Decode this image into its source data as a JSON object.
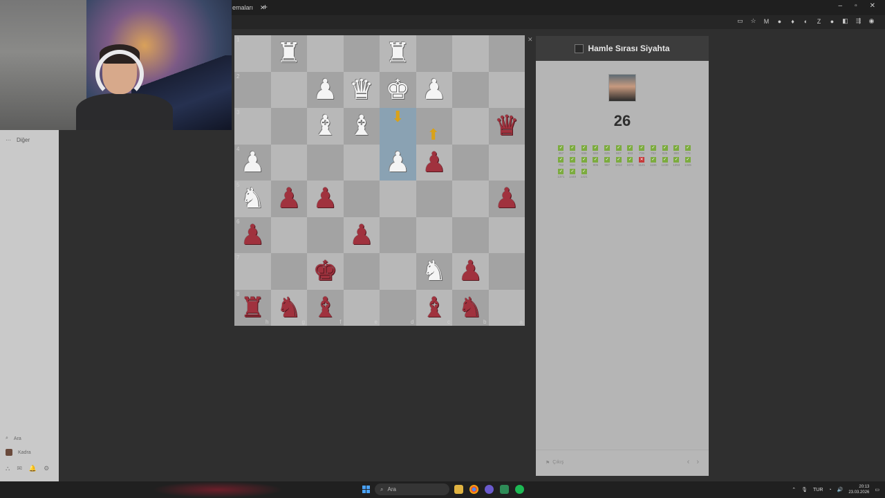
{
  "browser": {
    "tab_title": "emaları",
    "tab_close": "✕",
    "new_tab": "+",
    "window_controls": [
      "–",
      "▫",
      "✕"
    ],
    "extension_icons": [
      "▭",
      "☆",
      "M",
      "●",
      "♦",
      "◐",
      "Z",
      "●",
      "◧",
      "⇶",
      "◉"
    ]
  },
  "sidebar": {
    "top_dots": "···",
    "top_label": "Diğer",
    "search_label": "Ara",
    "profile_label": "Kadra",
    "bottom_icons": [
      "⛬",
      "✉",
      "🔔",
      "⚙"
    ]
  },
  "board": {
    "ranks": [
      "1",
      "2",
      "3",
      "4",
      "5",
      "6",
      "7",
      "8"
    ],
    "files": [
      "h",
      "g",
      "f",
      "e",
      "d",
      "c",
      "b",
      "a"
    ],
    "rows": [
      [
        {
          "p": ""
        },
        {
          "p": "♜",
          "c": "white"
        },
        {
          "p": ""
        },
        {
          "p": ""
        },
        {
          "p": "♜",
          "c": "white"
        },
        {
          "p": ""
        },
        {
          "p": ""
        },
        {
          "p": ""
        }
      ],
      [
        {
          "p": ""
        },
        {
          "p": ""
        },
        {
          "p": "♟",
          "c": "white"
        },
        {
          "p": "♛",
          "c": "white"
        },
        {
          "p": "♚",
          "c": "white"
        },
        {
          "p": "♟",
          "c": "white"
        },
        {
          "p": ""
        },
        {
          "p": ""
        }
      ],
      [
        {
          "p": ""
        },
        {
          "p": ""
        },
        {
          "p": "♝",
          "c": "white"
        },
        {
          "p": "♝",
          "c": "white"
        },
        {
          "p": "",
          "hl": true,
          "arrow": "down"
        },
        {
          "p": "",
          "arrow": "up"
        },
        {
          "p": ""
        },
        {
          "p": "♛",
          "c": "black"
        }
      ],
      [
        {
          "p": "♟",
          "c": "white"
        },
        {
          "p": ""
        },
        {
          "p": ""
        },
        {
          "p": ""
        },
        {
          "p": "♟",
          "c": "white",
          "hl": true
        },
        {
          "p": "♟",
          "c": "black"
        },
        {
          "p": ""
        },
        {
          "p": ""
        }
      ],
      [
        {
          "p": "♞",
          "c": "white"
        },
        {
          "p": "♟",
          "c": "black"
        },
        {
          "p": "♟",
          "c": "black"
        },
        {
          "p": ""
        },
        {
          "p": ""
        },
        {
          "p": ""
        },
        {
          "p": ""
        },
        {
          "p": "♟",
          "c": "black"
        }
      ],
      [
        {
          "p": "♟",
          "c": "black"
        },
        {
          "p": ""
        },
        {
          "p": ""
        },
        {
          "p": "♟",
          "c": "black"
        },
        {
          "p": ""
        },
        {
          "p": ""
        },
        {
          "p": ""
        },
        {
          "p": ""
        }
      ],
      [
        {
          "p": ""
        },
        {
          "p": ""
        },
        {
          "p": "♚",
          "c": "black"
        },
        {
          "p": ""
        },
        {
          "p": ""
        },
        {
          "p": "♞",
          "c": "white"
        },
        {
          "p": "♟",
          "c": "black"
        },
        {
          "p": ""
        }
      ],
      [
        {
          "p": "♜",
          "c": "black"
        },
        {
          "p": "♞",
          "c": "black"
        },
        {
          "p": "♝",
          "c": "black"
        },
        {
          "p": ""
        },
        {
          "p": ""
        },
        {
          "p": "♝",
          "c": "black"
        },
        {
          "p": "♞",
          "c": "black"
        },
        {
          "p": ""
        }
      ]
    ],
    "close_label": "✕",
    "arrow_color": "#d9a21a"
  },
  "panel": {
    "title": "Hamle Sırası Siyahta",
    "score": "26",
    "results": [
      {
        "ok": true,
        "rating": "357"
      },
      {
        "ok": true,
        "rating": "473"
      },
      {
        "ok": true,
        "rating": "598"
      },
      {
        "ok": true,
        "rating": "580"
      },
      {
        "ok": true,
        "rating": "625"
      },
      {
        "ok": true,
        "rating": "667"
      },
      {
        "ok": true,
        "rating": "693"
      },
      {
        "ok": true,
        "rating": "715"
      },
      {
        "ok": true,
        "rating": "752"
      },
      {
        "ok": true,
        "rating": "826"
      },
      {
        "ok": true,
        "rating": "880"
      },
      {
        "ok": true,
        "rating": "773"
      },
      {
        "ok": true,
        "rating": "762"
      },
      {
        "ok": true,
        "rating": "810"
      },
      {
        "ok": true,
        "rating": "874"
      },
      {
        "ok": true,
        "rating": "906"
      },
      {
        "ok": true,
        "rating": "967"
      },
      {
        "ok": true,
        "rating": "1012"
      },
      {
        "ok": true,
        "rating": "1074"
      },
      {
        "ok": false,
        "rating": "1121"
      },
      {
        "ok": true,
        "rating": "1165"
      },
      {
        "ok": true,
        "rating": "1230"
      },
      {
        "ok": true,
        "rating": "1253"
      },
      {
        "ok": true,
        "rating": "1345"
      },
      {
        "ok": true,
        "rating": "1371"
      },
      {
        "ok": true,
        "rating": "1449"
      },
      {
        "ok": true,
        "rating": "1421"
      }
    ],
    "exit_label": "Çıkış",
    "nav_prev": "‹",
    "nav_next": "›"
  },
  "taskbar": {
    "search_placeholder": "Ara",
    "language": "TUR",
    "time": "20:13",
    "date": "23.03.2026"
  }
}
